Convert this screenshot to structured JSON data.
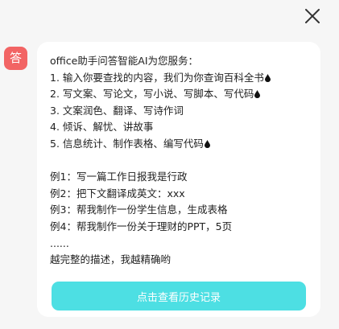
{
  "header": {
    "close_icon": "close-icon"
  },
  "message": {
    "avatar_label": "答",
    "intro": "office助手问答智能AI为您服务：",
    "services": [
      {
        "text": "1. 输入你要查找的内容，我们为你查询百科全书",
        "icon": "drop-icon"
      },
      {
        "text": "2. 写文案、写论文，写小说、写脚本、写代码",
        "icon": "drop-icon"
      },
      {
        "text": "3. 文案润色、翻译、写诗作词",
        "icon": null
      },
      {
        "text": "4. 倾诉、解忧、讲故事",
        "icon": null
      },
      {
        "text": "5. 信息统计、制作表格、编写代码",
        "icon": "drop-icon"
      }
    ],
    "examples": [
      "例1：写一篇工作日报我是行政",
      "例2：把下文翻译成英文：xxx",
      "例3：帮我制作一份学生信息，生成表格",
      "例4：帮我制作一份关于理财的PPT，5页"
    ],
    "ellipsis": "......",
    "closing": "越完整的描述，我越精确哟"
  },
  "actions": {
    "history_button": "点击查看历史记录"
  },
  "colors": {
    "avatar_bg": "#f26464",
    "button_bg": "#4ddfe3",
    "page_bg": "#f6f6f6"
  }
}
